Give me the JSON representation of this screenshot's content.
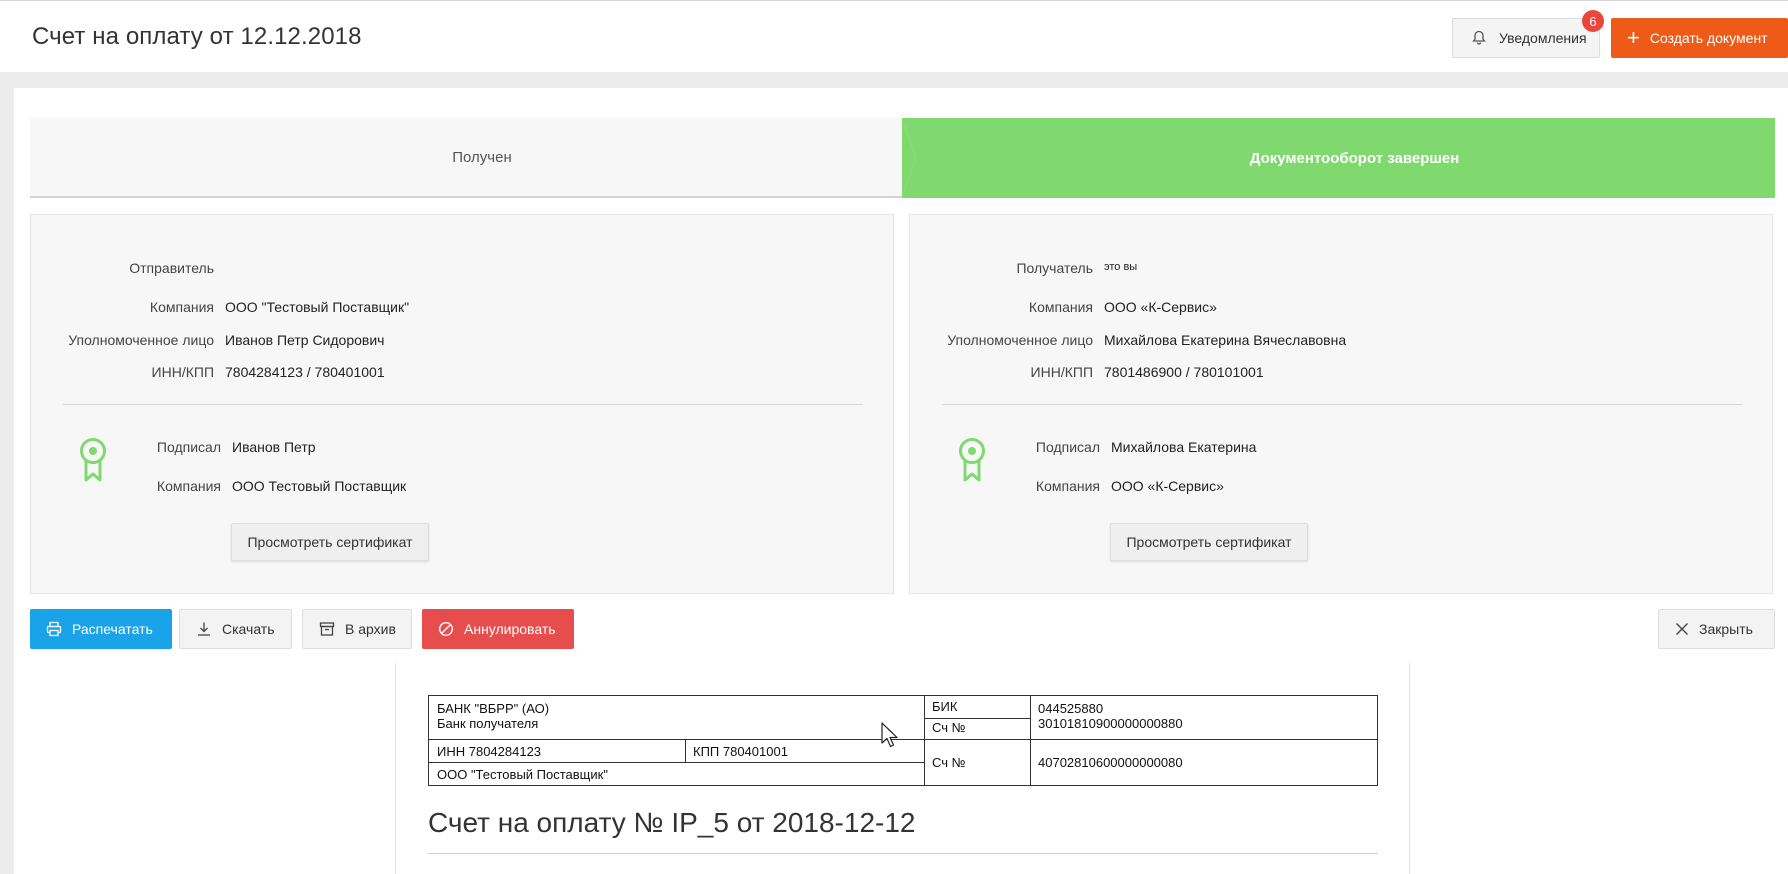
{
  "header": {
    "title": "Счет на оплату от 12.12.2018",
    "notifications_label": "Уведомления",
    "notifications_count": "6",
    "create_label": "Создать документ"
  },
  "steps": {
    "received": "Получен",
    "completed": "Документооборот завершен"
  },
  "sender": {
    "heading_label": "Отправитель",
    "heading_value": "",
    "company_label": "Компания",
    "company_value": "ООО \"Тестовый Поставщик\"",
    "authorized_label": "Уполномоченное лицо",
    "authorized_value": "Иванов Петр Сидорович",
    "inn_label": "ИНН/КПП",
    "inn_value": "7804284123 / 780401001",
    "signed_label": "Подписал",
    "signed_value": "Иванов Петр",
    "sign_company_label": "Компания",
    "sign_company_value": "ООО Тестовый Поставщик",
    "cert_button": "Просмотреть сертификат"
  },
  "recipient": {
    "heading_label": "Получатель",
    "heading_value": "это вы",
    "company_label": "Компания",
    "company_value": "ООО «К-Сервис»",
    "authorized_label": "Уполномоченное лицо",
    "authorized_value": "Михайлова Екатерина Вячеславовна",
    "inn_label": "ИНН/КПП",
    "inn_value": "7801486900 / 780101001",
    "signed_label": "Подписал",
    "signed_value": "Михайлова Екатерина",
    "sign_company_label": "Компания",
    "sign_company_value": "ООО «К-Сервис»",
    "cert_button": "Просмотреть сертификат"
  },
  "actions": {
    "print": "Распечатать",
    "download": "Скачать",
    "archive": "В архив",
    "cancel": "Аннулировать",
    "close": "Закрыть"
  },
  "document": {
    "bank_name": "БАНК \"ВБРР\" (АО)",
    "bank_caption": "Банк получателя",
    "bik_label": "БИК",
    "bik_value": "044525880",
    "corr_label": "Сч №",
    "corr_value": "30101810900000000880",
    "inn": "ИНН 7804284123",
    "kpp": "КПП 780401001",
    "account_label": "Сч №",
    "account_value": "40702810600000000080",
    "payee": "ООО \"Тестовый Поставщик\"",
    "title": "Счет на оплату № IP_5 от 2018-12-12"
  },
  "colors": {
    "accent_orange": "#ee5a17",
    "status_green": "#7fd96f",
    "print_blue": "#1aa3e8",
    "cancel_red": "#e74d4d",
    "badge_red": "#e8473d"
  }
}
